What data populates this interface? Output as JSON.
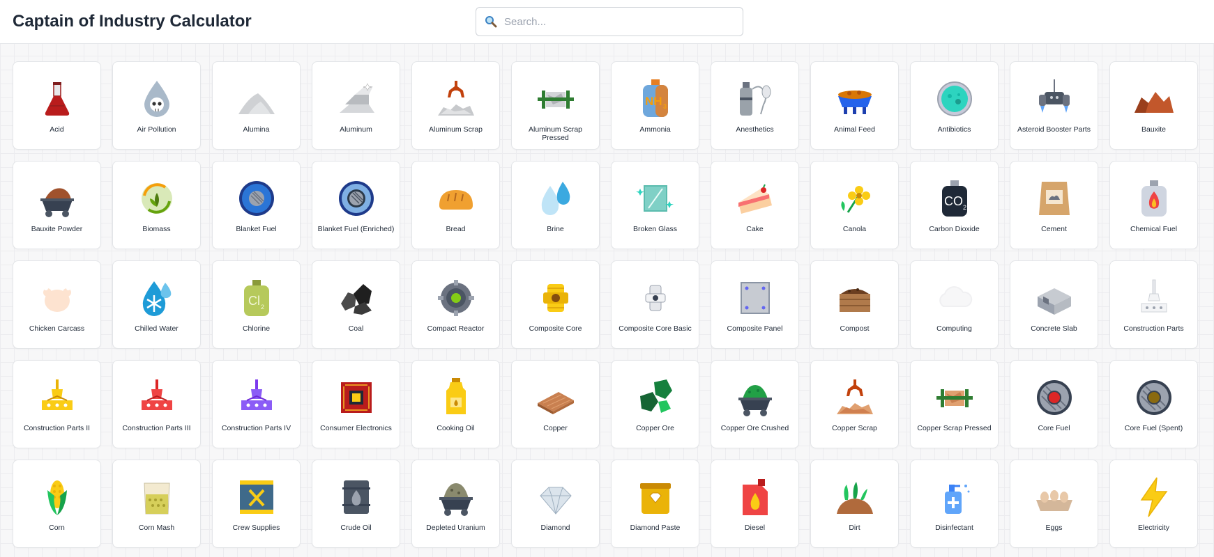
{
  "app": {
    "title": "Captain of Industry Calculator"
  },
  "search": {
    "placeholder": "Search..."
  },
  "products": [
    {
      "label": "Acid",
      "icon": "acid-flask-icon"
    },
    {
      "label": "Air Pollution",
      "icon": "air-pollution-skull-icon"
    },
    {
      "label": "Alumina",
      "icon": "alumina-pile-icon"
    },
    {
      "label": "Aluminum",
      "icon": "aluminum-ingot-icon"
    },
    {
      "label": "Aluminum Scrap",
      "icon": "aluminum-scrap-claw-icon"
    },
    {
      "label": "Aluminum Scrap Pressed",
      "icon": "aluminum-scrap-pressed-icon"
    },
    {
      "label": "Ammonia",
      "icon": "ammonia-tank-icon"
    },
    {
      "label": "Anesthetics",
      "icon": "anesthetics-tank-icon"
    },
    {
      "label": "Animal Feed",
      "icon": "animal-feed-trough-icon"
    },
    {
      "label": "Antibiotics",
      "icon": "antibiotics-petri-icon"
    },
    {
      "label": "Asteroid Booster Parts",
      "icon": "asteroid-booster-icon"
    },
    {
      "label": "Bauxite",
      "icon": "bauxite-rock-icon"
    },
    {
      "label": "Bauxite Powder",
      "icon": "bauxite-powder-cart-icon"
    },
    {
      "label": "Biomass",
      "icon": "biomass-leaf-icon"
    },
    {
      "label": "Blanket Fuel",
      "icon": "blanket-fuel-icon"
    },
    {
      "label": "Blanket Fuel (Enriched)",
      "icon": "blanket-fuel-enriched-icon"
    },
    {
      "label": "Bread",
      "icon": "bread-icon"
    },
    {
      "label": "Brine",
      "icon": "brine-drops-icon"
    },
    {
      "label": "Broken Glass",
      "icon": "broken-glass-icon"
    },
    {
      "label": "Cake",
      "icon": "cake-icon"
    },
    {
      "label": "Canola",
      "icon": "canola-flower-icon"
    },
    {
      "label": "Carbon Dioxide",
      "icon": "carbon-dioxide-tank-icon"
    },
    {
      "label": "Cement",
      "icon": "cement-bag-icon"
    },
    {
      "label": "Chemical Fuel",
      "icon": "chemical-fuel-tank-icon"
    },
    {
      "label": "Chicken Carcass",
      "icon": "chicken-carcass-icon"
    },
    {
      "label": "Chilled Water",
      "icon": "chilled-water-icon"
    },
    {
      "label": "Chlorine",
      "icon": "chlorine-tank-icon"
    },
    {
      "label": "Coal",
      "icon": "coal-icon"
    },
    {
      "label": "Compact Reactor",
      "icon": "compact-reactor-icon"
    },
    {
      "label": "Composite Core",
      "icon": "composite-core-icon"
    },
    {
      "label": "Composite Core Basic",
      "icon": "composite-core-basic-icon"
    },
    {
      "label": "Composite Panel",
      "icon": "composite-panel-icon"
    },
    {
      "label": "Compost",
      "icon": "compost-crate-icon"
    },
    {
      "label": "Computing",
      "icon": "computing-cloud-icon"
    },
    {
      "label": "Concrete Slab",
      "icon": "concrete-slab-icon"
    },
    {
      "label": "Construction Parts",
      "icon": "construction-parts-icon"
    },
    {
      "label": "Construction Parts II",
      "icon": "construction-parts-2-icon"
    },
    {
      "label": "Construction Parts III",
      "icon": "construction-parts-3-icon"
    },
    {
      "label": "Construction Parts IV",
      "icon": "construction-parts-4-icon"
    },
    {
      "label": "Consumer Electronics",
      "icon": "consumer-electronics-icon"
    },
    {
      "label": "Cooking Oil",
      "icon": "cooking-oil-icon"
    },
    {
      "label": "Copper",
      "icon": "copper-plate-icon"
    },
    {
      "label": "Copper Ore",
      "icon": "copper-ore-icon"
    },
    {
      "label": "Copper Ore Crushed",
      "icon": "copper-ore-crushed-icon"
    },
    {
      "label": "Copper Scrap",
      "icon": "copper-scrap-icon"
    },
    {
      "label": "Copper Scrap Pressed",
      "icon": "copper-scrap-pressed-icon"
    },
    {
      "label": "Core Fuel",
      "icon": "core-fuel-icon"
    },
    {
      "label": "Core Fuel (Spent)",
      "icon": "core-fuel-spent-icon"
    },
    {
      "label": "Corn",
      "icon": "corn-icon"
    },
    {
      "label": "Corn Mash",
      "icon": "corn-mash-icon"
    },
    {
      "label": "Crew Supplies",
      "icon": "crew-supplies-icon"
    },
    {
      "label": "Crude Oil",
      "icon": "crude-oil-barrel-icon"
    },
    {
      "label": "Depleted Uranium",
      "icon": "depleted-uranium-cart-icon"
    },
    {
      "label": "Diamond",
      "icon": "diamond-icon"
    },
    {
      "label": "Diamond Paste",
      "icon": "diamond-paste-icon"
    },
    {
      "label": "Diesel",
      "icon": "diesel-canister-icon"
    },
    {
      "label": "Dirt",
      "icon": "dirt-icon"
    },
    {
      "label": "Disinfectant",
      "icon": "disinfectant-bottle-icon"
    },
    {
      "label": "Eggs",
      "icon": "eggs-icon"
    },
    {
      "label": "Electricity",
      "icon": "electricity-bolt-icon"
    }
  ]
}
